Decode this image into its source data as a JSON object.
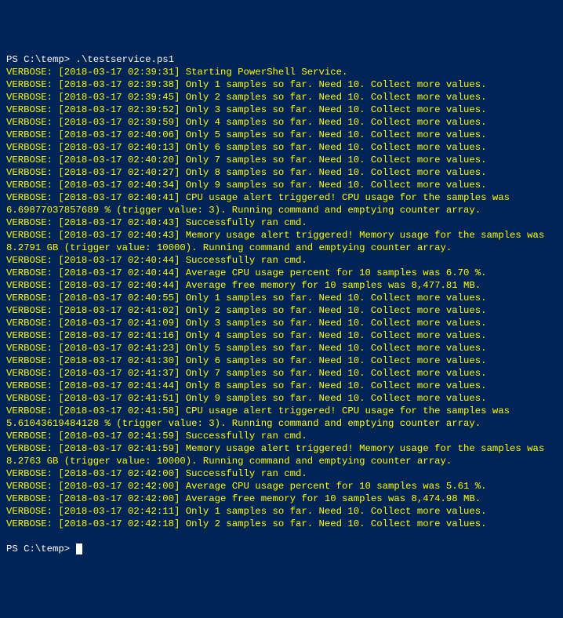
{
  "prompt_prefix": "PS C:\\temp>",
  "command": ".\\testservice.ps1",
  "lines": [
    "VERBOSE: [2018-03-17 02:39:31] Starting PowerShell Service.",
    "VERBOSE: [2018-03-17 02:39:38] Only 1 samples so far. Need 10. Collect more values.",
    "VERBOSE: [2018-03-17 02:39:45] Only 2 samples so far. Need 10. Collect more values.",
    "VERBOSE: [2018-03-17 02:39:52] Only 3 samples so far. Need 10. Collect more values.",
    "VERBOSE: [2018-03-17 02:39:59] Only 4 samples so far. Need 10. Collect more values.",
    "VERBOSE: [2018-03-17 02:40:06] Only 5 samples so far. Need 10. Collect more values.",
    "VERBOSE: [2018-03-17 02:40:13] Only 6 samples so far. Need 10. Collect more values.",
    "VERBOSE: [2018-03-17 02:40:20] Only 7 samples so far. Need 10. Collect more values.",
    "VERBOSE: [2018-03-17 02:40:27] Only 8 samples so far. Need 10. Collect more values.",
    "VERBOSE: [2018-03-17 02:40:34] Only 9 samples so far. Need 10. Collect more values.",
    "VERBOSE: [2018-03-17 02:40:41] CPU usage alert triggered! CPU usage for the samples was 6.69877037857689 % (trigger value: 3). Running command and emptying counter array.",
    "VERBOSE: [2018-03-17 02:40:43] Successfully ran cmd.",
    "VERBOSE: [2018-03-17 02:40:43] Memory usage alert triggered! Memory usage for the samples was 8.2791 GB (trigger value: 10000). Running command and emptying counter array.",
    "VERBOSE: [2018-03-17 02:40:44] Successfully ran cmd.",
    "VERBOSE: [2018-03-17 02:40:44] Average CPU usage percent for 10 samples was 6.70 %.",
    "VERBOSE: [2018-03-17 02:40:44] Average free memory for 10 samples was 8,477.81 MB.",
    "VERBOSE: [2018-03-17 02:40:55] Only 1 samples so far. Need 10. Collect more values.",
    "VERBOSE: [2018-03-17 02:41:02] Only 2 samples so far. Need 10. Collect more values.",
    "VERBOSE: [2018-03-17 02:41:09] Only 3 samples so far. Need 10. Collect more values.",
    "VERBOSE: [2018-03-17 02:41:16] Only 4 samples so far. Need 10. Collect more values.",
    "VERBOSE: [2018-03-17 02:41:23] Only 5 samples so far. Need 10. Collect more values.",
    "VERBOSE: [2018-03-17 02:41:30] Only 6 samples so far. Need 10. Collect more values.",
    "VERBOSE: [2018-03-17 02:41:37] Only 7 samples so far. Need 10. Collect more values.",
    "VERBOSE: [2018-03-17 02:41:44] Only 8 samples so far. Need 10. Collect more values.",
    "VERBOSE: [2018-03-17 02:41:51] Only 9 samples so far. Need 10. Collect more values.",
    "VERBOSE: [2018-03-17 02:41:58] CPU usage alert triggered! CPU usage for the samples was 5.61043619484128 % (trigger value: 3). Running command and emptying counter array.",
    "VERBOSE: [2018-03-17 02:41:59] Successfully ran cmd.",
    "VERBOSE: [2018-03-17 02:41:59] Memory usage alert triggered! Memory usage for the samples was 8.2763 GB (trigger value: 10000). Running command and emptying counter array.",
    "VERBOSE: [2018-03-17 02:42:00] Successfully ran cmd.",
    "VERBOSE: [2018-03-17 02:42:00] Average CPU usage percent for 10 samples was 5.61 %.",
    "VERBOSE: [2018-03-17 02:42:00] Average free memory for 10 samples was 8,474.98 MB.",
    "VERBOSE: [2018-03-17 02:42:11] Only 1 samples so far. Need 10. Collect more values.",
    "VERBOSE: [2018-03-17 02:42:18] Only 2 samples so far. Need 10. Collect more values."
  ]
}
